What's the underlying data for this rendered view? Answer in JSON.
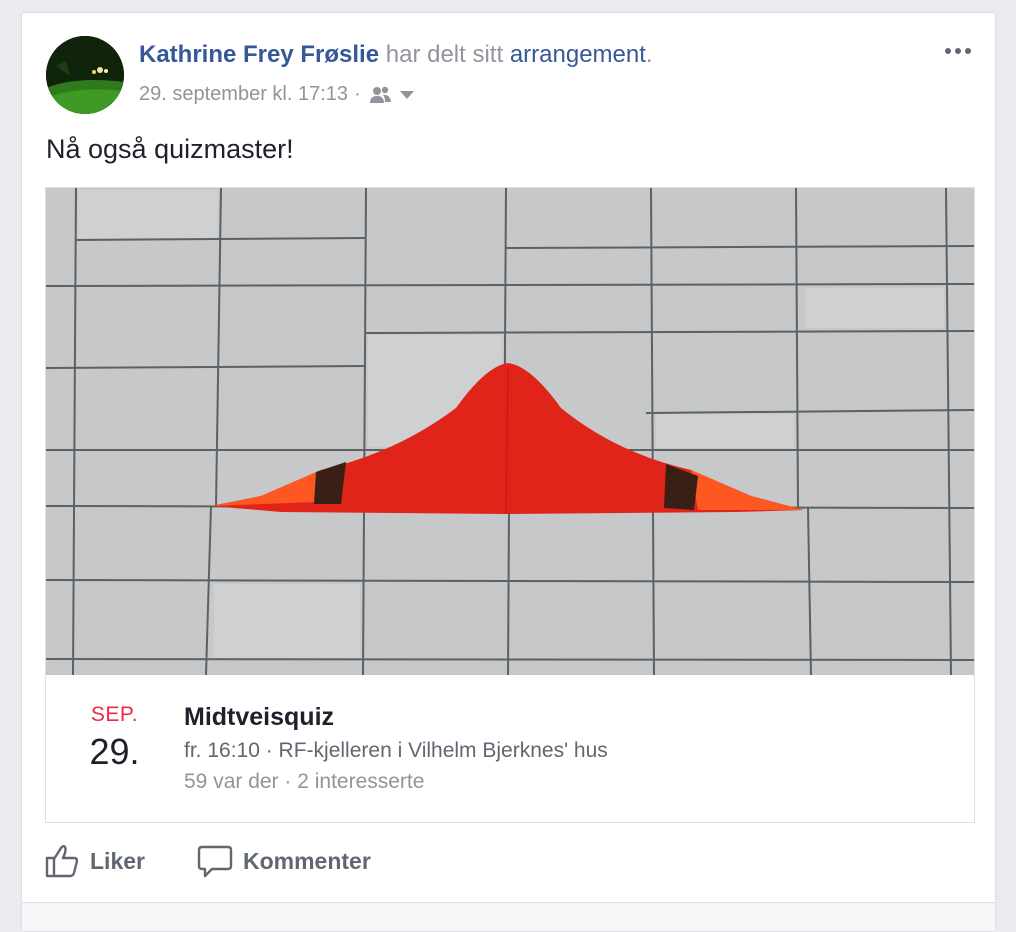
{
  "post": {
    "author": "Kathrine Frey Frøslie",
    "shared_text": " har delt sitt ",
    "event_word": "arrangement",
    "period": ".",
    "timestamp": "29. september kl. 17:13",
    "separator": "·",
    "audience_icon": "friends-icon",
    "body_text": "Nå også quizmaster!"
  },
  "event": {
    "month": "SEP.",
    "day": "29.",
    "title": "Midtveisquiz",
    "when_where": "fr. 16:10 · RF-kjelleren i Vilhelm Bjerknes' hus",
    "stats": "59 var der · 2 interesserte"
  },
  "actions": {
    "like_label": "Liker",
    "comment_label": "Kommenter"
  },
  "colors": {
    "link": "#365899",
    "month_red": "#f02849",
    "muted": "#90949c",
    "curve_red": "#e0241a"
  }
}
